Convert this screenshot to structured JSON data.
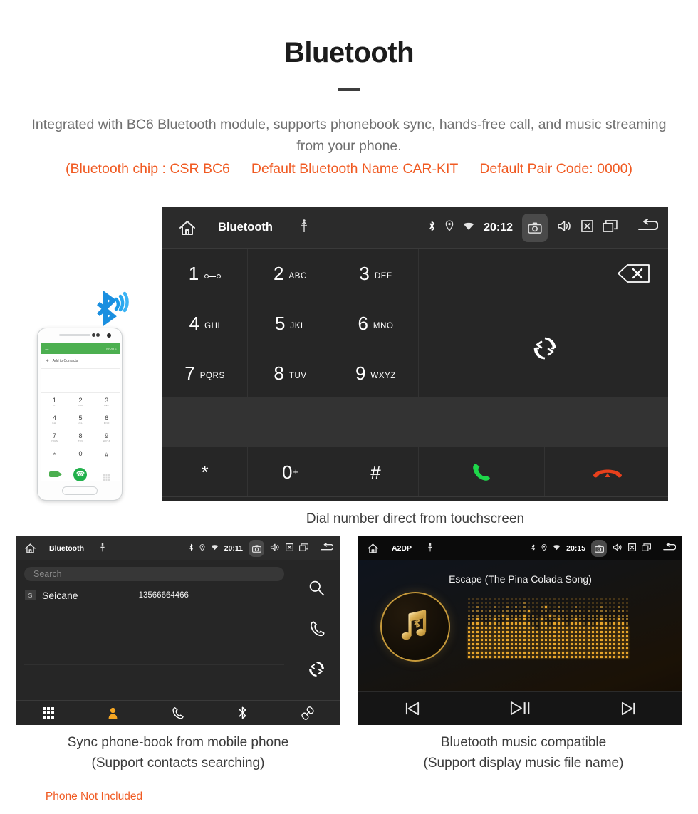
{
  "header": {
    "title": "Bluetooth",
    "description": "Integrated with BC6 Bluetooth module, supports phonebook sync, hands-free call, and music streaming from your phone.",
    "spec_chip": "(Bluetooth chip : CSR BC6",
    "spec_name": "Default Bluetooth Name CAR-KIT",
    "spec_pair": "Default Pair Code: 0000)",
    "accent_color": "#f05a22",
    "text_color": "#6f6f6f"
  },
  "phone_illustration": {
    "app_back": "←",
    "app_more": "MORE",
    "add_contacts": "Add to Contacts",
    "plus": "+",
    "keys": [
      {
        "num": "1",
        "sub": "∞"
      },
      {
        "num": "2",
        "sub": "ABC"
      },
      {
        "num": "3",
        "sub": "DEF"
      },
      {
        "num": "4",
        "sub": "GHI"
      },
      {
        "num": "5",
        "sub": "JKL"
      },
      {
        "num": "6",
        "sub": "MNO"
      },
      {
        "num": "7",
        "sub": "PQRS"
      },
      {
        "num": "8",
        "sub": "TUV"
      },
      {
        "num": "9",
        "sub": "WXYZ"
      },
      {
        "num": "*",
        "sub": ""
      },
      {
        "num": "0",
        "sub": "+"
      },
      {
        "num": "#",
        "sub": ""
      }
    ],
    "caption": "Phone Not Included",
    "caption_color": "#f05a22"
  },
  "dialer": {
    "statusbar": {
      "title": "Bluetooth",
      "time": "20:12",
      "home_icon": "home-icon",
      "usb_icon": "usb-icon",
      "bluetooth_icon": "bluetooth-icon",
      "location_icon": "location-icon",
      "wifi_icon": "wifi-icon",
      "camera_icon": "camera-icon",
      "volume_icon": "volume-icon",
      "close_icon": "close-box-icon",
      "recents_icon": "recents-icon",
      "back_icon": "back-icon"
    },
    "keys": [
      {
        "num": "1",
        "sub": "",
        "voicemail": true
      },
      {
        "num": "2",
        "sub": "ABC"
      },
      {
        "num": "3",
        "sub": "DEF"
      },
      {
        "num": "4",
        "sub": "GHI"
      },
      {
        "num": "5",
        "sub": "JKL"
      },
      {
        "num": "6",
        "sub": "MNO"
      },
      {
        "num": "7",
        "sub": "PQRS"
      },
      {
        "num": "8",
        "sub": "TUV"
      },
      {
        "num": "9",
        "sub": "WXYZ"
      },
      {
        "num": "*",
        "sub": ""
      },
      {
        "num": "0",
        "sub": "+"
      },
      {
        "num": "#",
        "sub": ""
      }
    ],
    "actions": {
      "backspace": "backspace-icon",
      "sync": "sync-icon",
      "call": "call-icon",
      "hangup": "hangup-icon",
      "call_color": "#1ed64a",
      "hangup_color": "#e8401c"
    },
    "navbar": [
      {
        "name": "dialpad",
        "icon": "dialpad-icon",
        "active": true
      },
      {
        "name": "contacts",
        "icon": "person-icon",
        "active": false
      },
      {
        "name": "call-log",
        "icon": "phone-icon",
        "active": false
      },
      {
        "name": "bluetooth",
        "icon": "bluetooth-icon",
        "active": false
      },
      {
        "name": "pair-link",
        "icon": "link-icon",
        "active": false
      }
    ],
    "active_color": "#f5a623",
    "caption": "Dial number direct from touchscreen"
  },
  "phonebook": {
    "statusbar": {
      "title": "Bluetooth",
      "time": "20:11"
    },
    "search_placeholder": "Search",
    "contacts": [
      {
        "initial": "S",
        "name": "Seicane",
        "number": "13566664466"
      }
    ],
    "empty_rows": 4,
    "side_actions": [
      {
        "name": "search",
        "icon": "search-icon"
      },
      {
        "name": "call",
        "icon": "phone-icon"
      },
      {
        "name": "sync",
        "icon": "sync-icon"
      }
    ],
    "navbar": [
      {
        "name": "dialpad",
        "icon": "dialpad-icon",
        "active": false
      },
      {
        "name": "contacts",
        "icon": "person-icon",
        "active": true
      },
      {
        "name": "call-log",
        "icon": "phone-icon",
        "active": false
      },
      {
        "name": "bluetooth",
        "icon": "bluetooth-icon",
        "active": false
      },
      {
        "name": "pair-link",
        "icon": "link-icon",
        "active": false
      }
    ],
    "caption_line1": "Sync phone-book from mobile phone",
    "caption_line2": "(Support contacts searching)"
  },
  "music": {
    "statusbar": {
      "title": "A2DP",
      "time": "20:15"
    },
    "track_title": "Escape (The Pina Colada Song)",
    "album_icon": "music-note-bluetooth-icon",
    "controls": [
      {
        "name": "previous",
        "icon": "skip-previous-icon"
      },
      {
        "name": "play-pause",
        "icon": "play-pause-icon"
      },
      {
        "name": "next",
        "icon": "skip-next-icon"
      }
    ],
    "equalizer": {
      "columns": 38,
      "rows": 15,
      "levels": [
        11,
        12,
        13,
        12,
        11,
        12,
        13,
        11,
        12,
        13,
        12,
        13,
        12,
        14,
        12,
        11,
        10,
        13,
        12,
        11,
        12,
        13,
        12,
        11,
        12,
        13,
        12,
        11,
        12,
        11,
        12,
        13,
        12,
        11,
        12,
        13,
        12,
        11
      ],
      "dot_color": "#e7a52b"
    },
    "caption_line1": "Bluetooth music compatible",
    "caption_line2": "(Support display music file name)"
  }
}
